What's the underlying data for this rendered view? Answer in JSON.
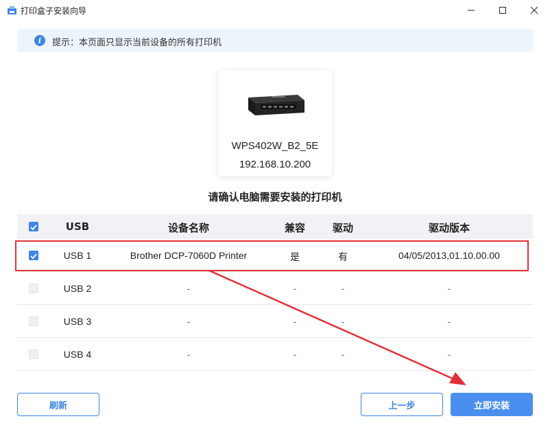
{
  "window": {
    "title": "打印盒子安装向导",
    "app_icon": "printer-icon"
  },
  "notice": {
    "icon": "info-icon",
    "icon_glyph": "i",
    "text": "提示：本页面只显示当前设备的所有打印机"
  },
  "device": {
    "name": "WPS402W_B2_5E",
    "ip": "192.168.10.200"
  },
  "section_title": "请确认电脑需要安装的打印机",
  "table": {
    "headers": {
      "usb": "USB",
      "name": "设备名称",
      "compat": "兼容",
      "driver": "驱动",
      "version": "驱动版本"
    },
    "header_checked": true,
    "rows": [
      {
        "checked": true,
        "usb": "USB 1",
        "name": "Brother DCP-7060D Printer",
        "compat": "是",
        "driver": "有",
        "version": "04/05/2013,01.10.00.00"
      },
      {
        "checked": false,
        "usb": "USB 2",
        "name": "-",
        "compat": "-",
        "driver": "-",
        "version": "-"
      },
      {
        "checked": false,
        "usb": "USB 3",
        "name": "-",
        "compat": "-",
        "driver": "-",
        "version": "-"
      },
      {
        "checked": false,
        "usb": "USB 4",
        "name": "-",
        "compat": "-",
        "driver": "-",
        "version": "-"
      }
    ]
  },
  "buttons": {
    "refresh": "刷新",
    "prev": "上一步",
    "install": "立即安装"
  },
  "colors": {
    "accent": "#3d84e6",
    "highlight": "#e23136"
  }
}
